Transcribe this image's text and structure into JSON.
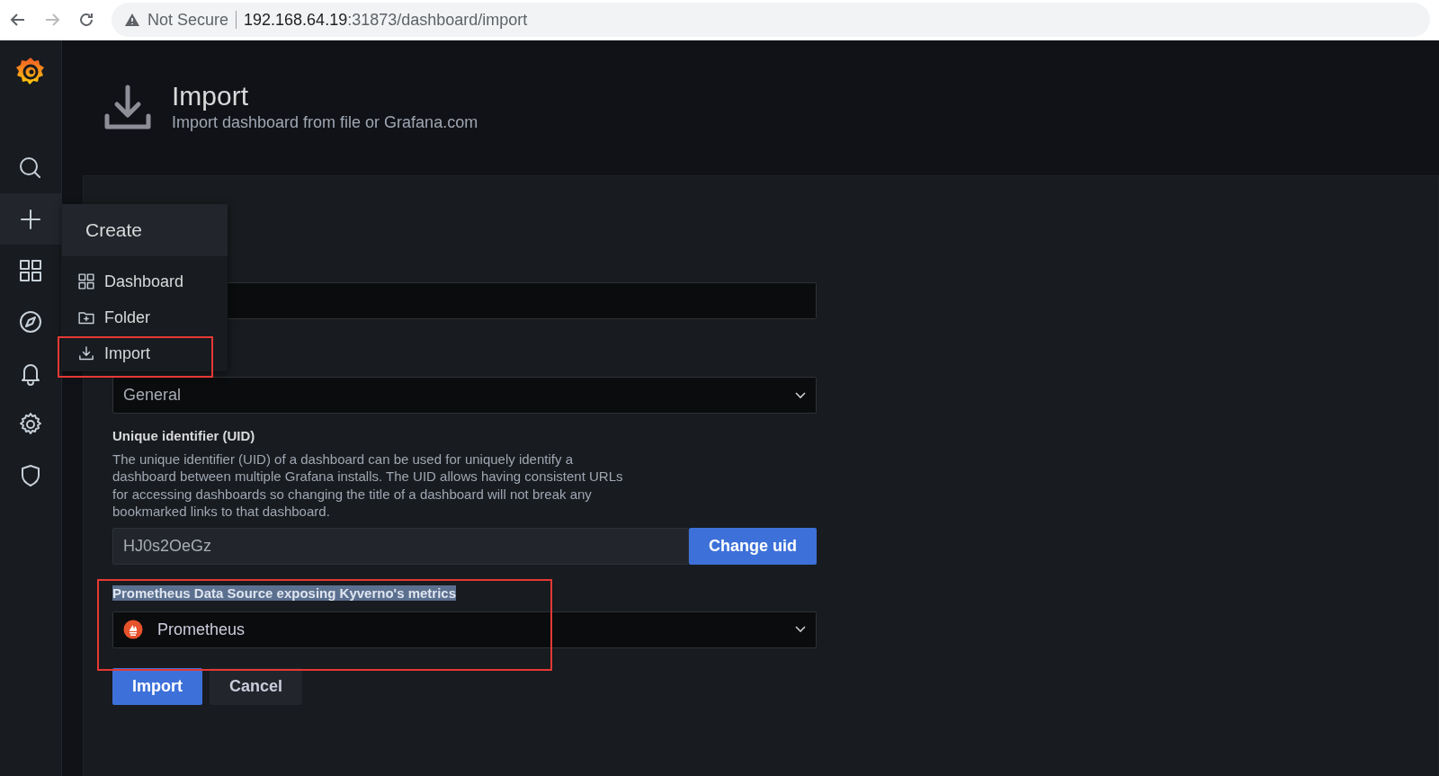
{
  "browser": {
    "security": "Not Secure",
    "url_host": "192.168.64.19",
    "url_path": ":31873/dashboard/import"
  },
  "sidebar": {
    "items": [
      {
        "kind": "search",
        "selected": false
      },
      {
        "kind": "plus",
        "selected": true
      },
      {
        "kind": "apps",
        "selected": false
      },
      {
        "kind": "compass",
        "selected": false
      },
      {
        "kind": "bell",
        "selected": false
      },
      {
        "kind": "gear",
        "selected": false
      },
      {
        "kind": "shield",
        "selected": false
      }
    ]
  },
  "create_menu": {
    "title": "Create",
    "items": [
      {
        "kind": "apps",
        "label": "Dashboard",
        "framed": false
      },
      {
        "kind": "folder",
        "label": "Folder",
        "framed": false
      },
      {
        "kind": "import",
        "label": "Import",
        "framed": true
      }
    ]
  },
  "page_header": {
    "title": "Import",
    "subtitle": "Import dashboard from file or Grafana.com"
  },
  "form": {
    "folder": {
      "value": "General"
    },
    "uid": {
      "label": "Unique identifier (UID)",
      "description": "The unique identifier (UID) of a dashboard can be used for uniquely identify a dashboard between multiple Grafana installs. The UID allows having consistent URLs for accessing dashboards so changing the title of a dashboard will not break any bookmarked links to that dashboard.",
      "value": "HJ0s2OeGz",
      "button": "Change uid"
    },
    "datasource": {
      "label": "Prometheus Data Source exposing Kyverno's metrics",
      "label_selected": true,
      "value": "Prometheus",
      "framed": true
    },
    "buttons": [
      {
        "kind": "primary",
        "label": "Import"
      },
      {
        "kind": "secondary",
        "label": "Cancel"
      }
    ]
  }
}
